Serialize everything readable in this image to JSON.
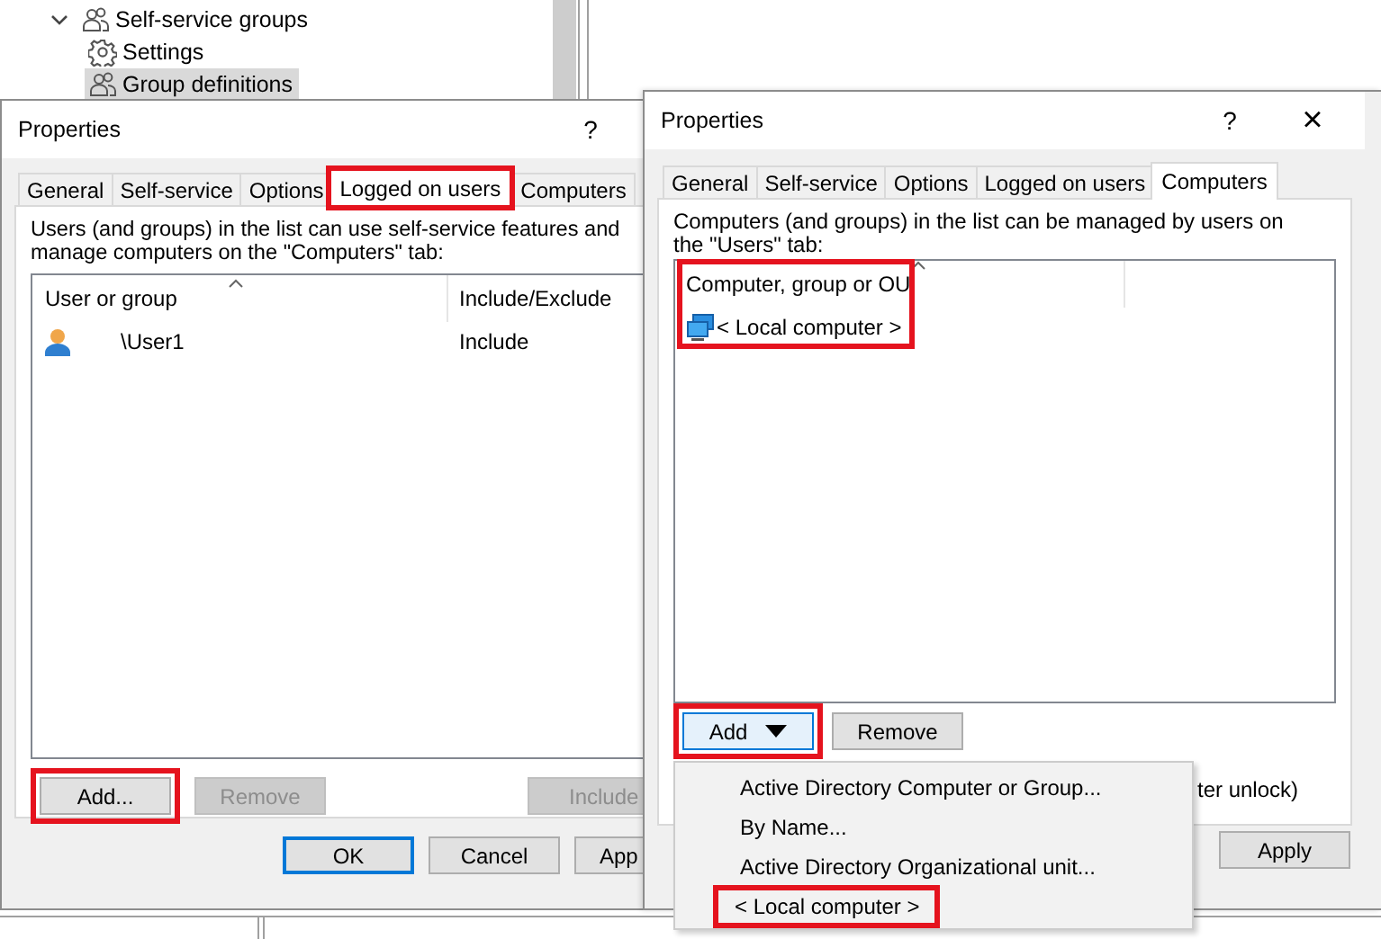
{
  "tree": {
    "items": [
      {
        "label": "Self-service groups",
        "kind": "group",
        "expanded": true,
        "selected": false,
        "children": [
          {
            "label": "Settings",
            "kind": "settings",
            "selected": false
          },
          {
            "label": "Group definitions",
            "kind": "group",
            "selected": true
          }
        ]
      }
    ]
  },
  "dialogs": [
    {
      "title": "Properties",
      "help": "?",
      "tabs": [
        {
          "label": "General",
          "selected": false,
          "highlighted": false
        },
        {
          "label": "Self-service",
          "selected": false,
          "highlighted": false
        },
        {
          "label": "Options",
          "selected": false,
          "highlighted": false
        },
        {
          "label": "Logged on users",
          "selected": true,
          "highlighted": true
        },
        {
          "label": "Computers",
          "selected": false,
          "highlighted": false
        }
      ],
      "description": "Users (and groups) in the list can use self-service features and manage computers on the \"Computers\" tab:",
      "list": {
        "columns": [
          "User or group",
          "Include/Exclude"
        ],
        "highlighted": false,
        "rows": [
          {
            "kind": "user",
            "cells": [
              "\\User1",
              "Include"
            ]
          }
        ]
      },
      "buttons": [
        {
          "label": "Add...",
          "kind": "plain",
          "disabled": false,
          "highlighted": true
        },
        {
          "label": "Remove",
          "kind": "plain",
          "disabled": true,
          "highlighted": false
        },
        {
          "label": "Include",
          "kind": "plain",
          "disabled": true,
          "highlighted": false
        }
      ],
      "footer_buttons": [
        {
          "label": "OK",
          "default": true
        },
        {
          "label": "Cancel",
          "default": false
        },
        {
          "label": "App",
          "default": false
        }
      ]
    },
    {
      "title": "Properties",
      "help": "?",
      "close": "×",
      "tabs": [
        {
          "label": "General",
          "selected": false,
          "highlighted": false
        },
        {
          "label": "Self-service",
          "selected": false,
          "highlighted": false
        },
        {
          "label": "Options",
          "selected": false,
          "highlighted": false
        },
        {
          "label": "Logged on users",
          "selected": false,
          "highlighted": false
        },
        {
          "label": "Computers",
          "selected": true,
          "highlighted": false
        }
      ],
      "description": "Computers (and groups) in the list can be managed by users on the \"Users\" tab:",
      "list": {
        "columns": [
          "Computer, group or OU"
        ],
        "highlighted": true,
        "rows": [
          {
            "kind": "computer",
            "cells": [
              "< Local computer >"
            ]
          }
        ]
      },
      "buttons": [
        {
          "label": "Add",
          "kind": "dropdown",
          "disabled": false,
          "highlighted": true
        },
        {
          "label": "Remove",
          "kind": "plain",
          "disabled": false,
          "highlighted": false
        }
      ],
      "option_label": "ter unlock)",
      "footer_buttons": [
        {
          "label": "Apply",
          "default": false
        }
      ],
      "menu": {
        "items": [
          {
            "label": "Active Directory Computer or Group...",
            "highlighted": false
          },
          {
            "label": "By Name...",
            "highlighted": false
          },
          {
            "label": "Active Directory Organizational unit...",
            "highlighted": false
          },
          {
            "label": "< Local computer >",
            "highlighted": true
          }
        ]
      }
    }
  ]
}
